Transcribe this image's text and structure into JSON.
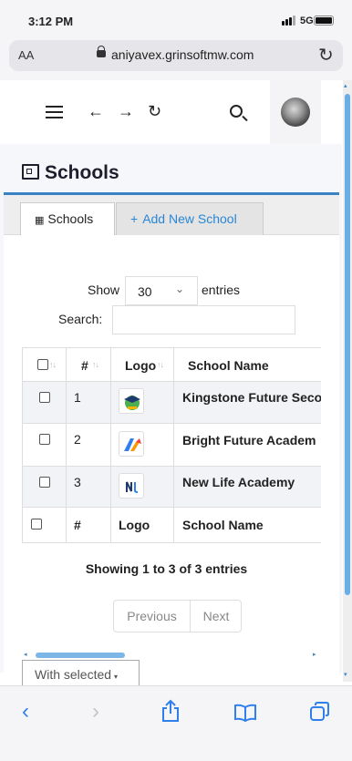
{
  "status_bar": {
    "time": "3:12 PM",
    "network": "5G"
  },
  "browser": {
    "text_size": "AA",
    "url": "aniyavex.grinsoftmw.com"
  },
  "page": {
    "title": "Schools"
  },
  "tabs": [
    {
      "label": "Schools",
      "active": true
    },
    {
      "label": "Add New School",
      "active": false
    }
  ],
  "controls": {
    "show_label": "Show",
    "entries_value": "30",
    "entries_label": "entries",
    "search_label": "Search:",
    "search_value": ""
  },
  "table": {
    "headers": [
      "#",
      "Logo",
      "School Name"
    ],
    "rows": [
      {
        "num": "1",
        "logo": "graduation-cap-logo",
        "name": "Kingstone Future Seco"
      },
      {
        "num": "2",
        "logo": "colorful-arrow-logo",
        "name": "Bright Future Academ"
      },
      {
        "num": "3",
        "logo": "nl-letters-logo",
        "name": "New Life Academy"
      }
    ],
    "footer": [
      "#",
      "Logo",
      "School Name"
    ]
  },
  "info": "Showing 1 to 3 of 3 entries",
  "pagination": {
    "previous": "Previous",
    "next": "Next"
  },
  "bulk_action": {
    "label": "With selected"
  },
  "colors": {
    "accent": "#2a86d4",
    "card_border": "#3b82c4",
    "title": "#1e1e2d",
    "ios_blue": "#2f80ed"
  }
}
